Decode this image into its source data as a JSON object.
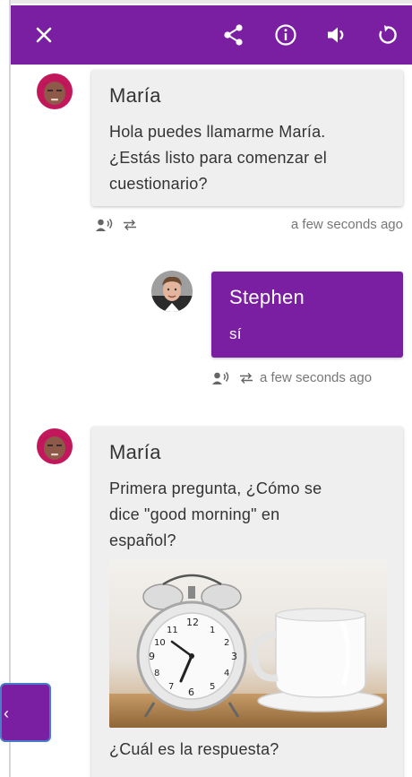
{
  "toolbar": {
    "close_icon": "close-icon",
    "share_icon": "share-icon",
    "info_icon": "info-icon",
    "volume_icon": "volume-icon",
    "reload_icon": "reload-icon",
    "color": "#7b1fa2"
  },
  "messages": [
    {
      "sender": "María",
      "role": "bot",
      "lines": [
        "Hola puedes llamarme María.",
        "¿Estás listo para comenzar el",
        "cuestionario?"
      ],
      "time": "a few seconds ago"
    },
    {
      "sender": "Stephen",
      "role": "user",
      "lines": [
        "sí"
      ],
      "time": "a few seconds ago"
    },
    {
      "sender": "María",
      "role": "bot",
      "lines": [
        "Primera pregunta, ¿Cómo se",
        "dice \"good morning\" en",
        "español?"
      ],
      "footer": "¿Cuál es la respuesta?"
    }
  ],
  "floating_button": {
    "glyph": "‹"
  }
}
